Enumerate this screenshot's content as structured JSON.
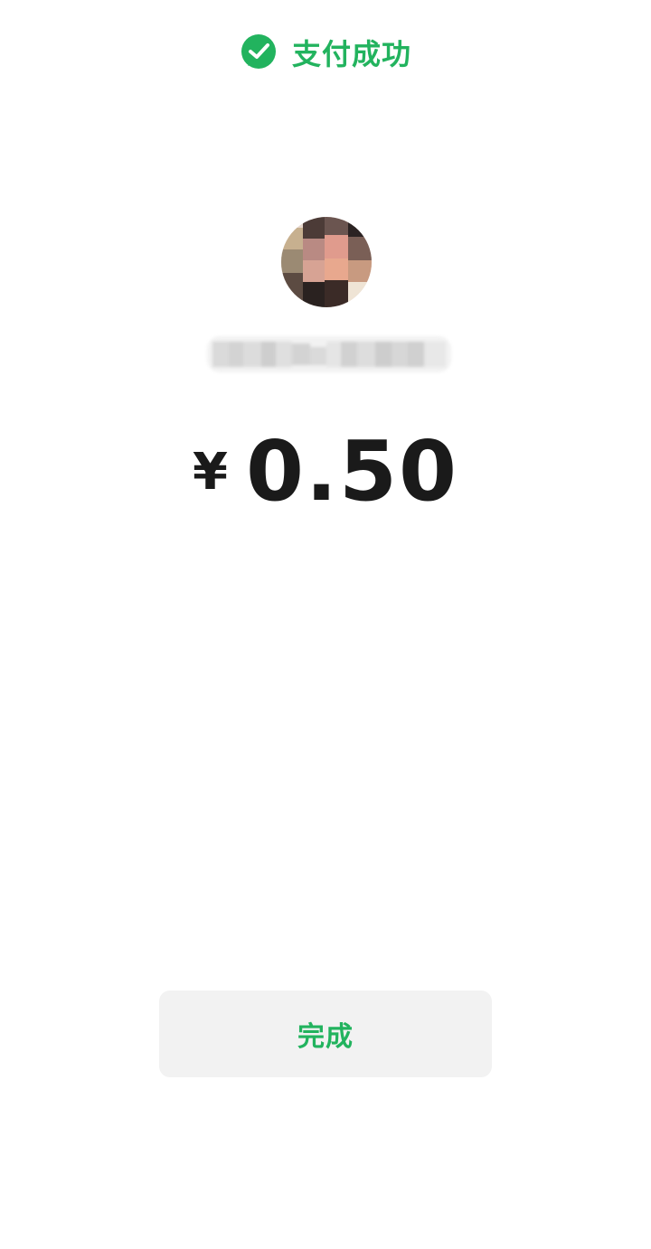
{
  "header": {
    "icon": "check-circle-icon",
    "title": "支付成功",
    "accent_color": "#22b35e"
  },
  "payee": {
    "avatar_icon": "avatar-image-pixelated"
  },
  "payment": {
    "currency_symbol": "¥",
    "amount": "0.50"
  },
  "actions": {
    "done_label": "完成"
  }
}
